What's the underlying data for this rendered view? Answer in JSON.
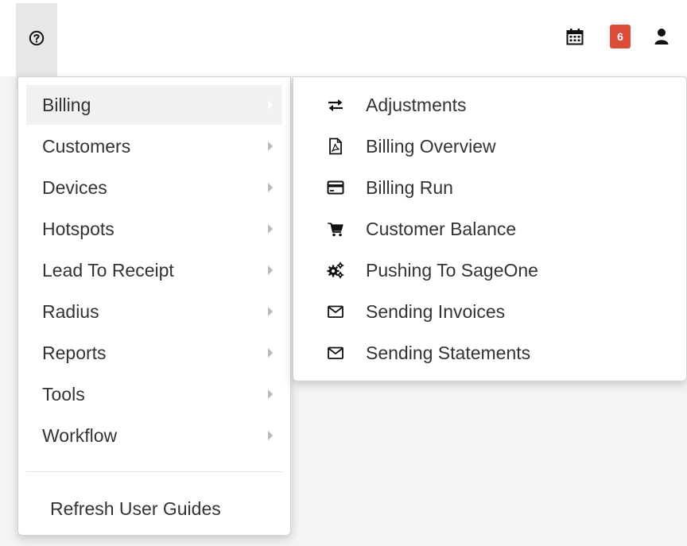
{
  "topbar": {
    "help_icon": "question-circle-icon",
    "calendar_icon": "calendar-icon",
    "notification_count": "6",
    "user_icon": "user-icon"
  },
  "menu": {
    "items": [
      {
        "label": "Billing",
        "active": true
      },
      {
        "label": "Customers"
      },
      {
        "label": "Devices"
      },
      {
        "label": "Hotspots"
      },
      {
        "label": "Lead To Receipt"
      },
      {
        "label": "Radius"
      },
      {
        "label": "Reports"
      },
      {
        "label": "Tools"
      },
      {
        "label": "Workflow"
      }
    ],
    "refresh_label": "Refresh User Guides"
  },
  "submenu": {
    "items": [
      {
        "label": "Adjustments",
        "icon": "exchange-icon"
      },
      {
        "label": "Billing Overview",
        "icon": "file-pdf-icon"
      },
      {
        "label": "Billing Run",
        "icon": "credit-card-icon"
      },
      {
        "label": "Customer Balance",
        "icon": "shopping-cart-icon"
      },
      {
        "label": "Pushing To SageOne",
        "icon": "cogs-icon"
      },
      {
        "label": "Sending Invoices",
        "icon": "envelope-icon"
      },
      {
        "label": "Sending Statements",
        "icon": "envelope-icon"
      }
    ]
  },
  "colors": {
    "badge": "#dd4b39",
    "active_item_bg": "#f1f1f1",
    "text": "#333333"
  }
}
